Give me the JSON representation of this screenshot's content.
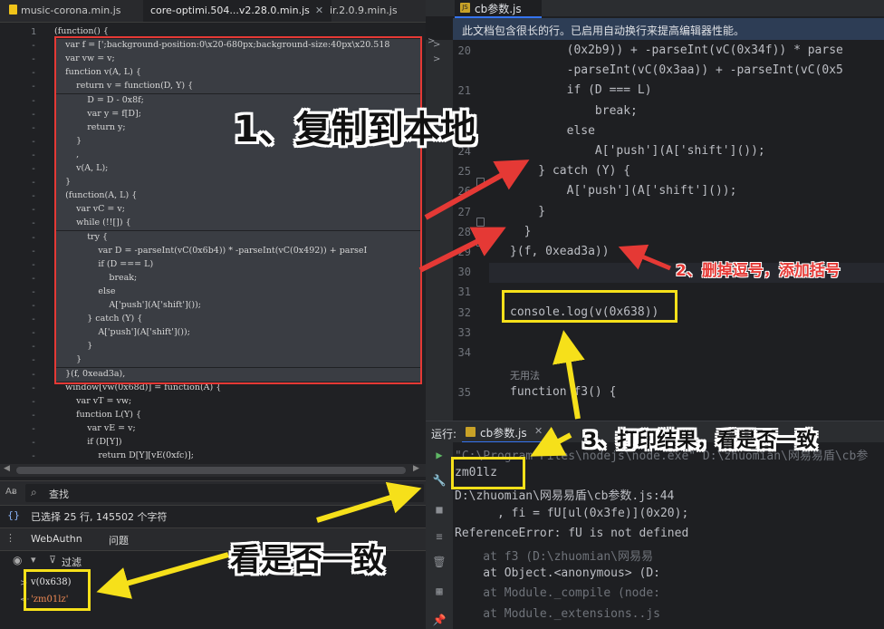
{
  "left_tabs": [
    {
      "label": "music-corona.min.js",
      "active": false
    },
    {
      "label": "core-optimi.504...v2.28.0.min.js",
      "active": true
    },
    {
      "label": "ir.2.0.9.min.js",
      "active": false
    }
  ],
  "left_code": [
    {
      "ln": "1",
      "text": "(function() {"
    },
    {
      "ln": "-",
      "text": "    var f = [';background-position:0\\x20-680px;background-size:40px\\x20.518"
    },
    {
      "ln": "-",
      "text": "    var vw = v;"
    },
    {
      "ln": "-",
      "text": "    function v(A, L) {"
    },
    {
      "ln": "-",
      "text": "        return v = function(D, Y) {"
    },
    {
      "ln": "-",
      "text": "            D = D - 0x8f;"
    },
    {
      "ln": "-",
      "text": "            var y = f[D];"
    },
    {
      "ln": "-",
      "text": "            return y;"
    },
    {
      "ln": "-",
      "text": "        }"
    },
    {
      "ln": "-",
      "text": "        ,"
    },
    {
      "ln": "-",
      "text": "        v(A, L);"
    },
    {
      "ln": "-",
      "text": "    }"
    },
    {
      "ln": "-",
      "text": "    (function(A, L) {"
    },
    {
      "ln": "-",
      "text": "        var vC = v;"
    },
    {
      "ln": "-",
      "text": "        while (!![]) {"
    },
    {
      "ln": "-",
      "text": "            try {"
    },
    {
      "ln": "-",
      "text": "                var D = -parseInt(vC(0x6b4)) * -parseInt(vC(0x492)) + parseI"
    },
    {
      "ln": "-",
      "text": "                if (D === L)"
    },
    {
      "ln": "-",
      "text": "                    break;"
    },
    {
      "ln": "-",
      "text": "                else"
    },
    {
      "ln": "-",
      "text": "                    A['push'](A['shift']());"
    },
    {
      "ln": "-",
      "text": "            } catch (Y) {"
    },
    {
      "ln": "-",
      "text": "                A['push'](A['shift']());"
    },
    {
      "ln": "-",
      "text": "            }"
    },
    {
      "ln": "-",
      "text": "        }"
    },
    {
      "ln": "-",
      "text": "    }(f, 0xead3a),"
    },
    {
      "ln": "-",
      "text": "    window[vw(0x68d)] = function(A) {"
    },
    {
      "ln": "-",
      "text": "        var vT = vw;"
    },
    {
      "ln": "-",
      "text": "        function L(Y) {"
    },
    {
      "ln": "-",
      "text": "            var vE = v;"
    },
    {
      "ln": "-",
      "text": "            if (D[Y])"
    },
    {
      "ln": "-",
      "text": "                return D[Y][vE(0xfc)];"
    }
  ],
  "search": {
    "icon_label": "Aᴃ",
    "placeholder": "查找"
  },
  "status": {
    "text": "已选择 25 行, 145502 个字符"
  },
  "bottom_tabs": {
    "webauthn": "WebAuthn",
    "issues": "问题"
  },
  "filter": {
    "label": "过滤"
  },
  "console_lines": [
    {
      "prefix": ">",
      "text": "v(0x638)"
    },
    {
      "prefix": "<·",
      "text": "'zm01lz'"
    }
  ],
  "right_tab": {
    "label": "cb参数.js"
  },
  "banner": {
    "text": "此文档包含很长的行。已启用自动换行来提高编辑器性能。"
  },
  "right_code": [
    {
      "ln": "20",
      "text": "        (0x2b9)) + -parseInt(vC(0x34f)) * parse"
    },
    {
      "ln": "",
      "text": "        -parseInt(vC(0x3aa)) + -parseInt(vC(0x5"
    },
    {
      "ln": "21",
      "text": "        if (D === L)"
    },
    {
      "ln": "22",
      "text": "            break;"
    },
    {
      "ln": "23",
      "text": "        else"
    },
    {
      "ln": "24",
      "text": "            A['push'](A['shift']());"
    },
    {
      "ln": "25",
      "text": "    } catch (Y) {"
    },
    {
      "ln": "26",
      "text": "        A['push'](A['shift']());"
    },
    {
      "ln": "27",
      "text": "    }"
    },
    {
      "ln": "28",
      "text": "  }"
    },
    {
      "ln": "29",
      "text": "}(f, 0xead3a))"
    },
    {
      "ln": "30",
      "text": ""
    },
    {
      "ln": "31",
      "text": ""
    },
    {
      "ln": "32",
      "text": "console.log(v(0x638))"
    },
    {
      "ln": "33",
      "text": ""
    },
    {
      "ln": "34",
      "text": ""
    },
    {
      "ln": "",
      "text": "无用法"
    },
    {
      "ln": "35",
      "text": "function f3() {"
    }
  ],
  "run": {
    "label": "运行:",
    "config": "cb参数.js"
  },
  "run_output": [
    {
      "text": "\"C:\\Program Files\\nodejs\\node.exe\" D:\\zhuomian\\网易易盾\\cb参",
      "cls": "gray"
    },
    {
      "text": "zm01lz",
      "cls": ""
    },
    {
      "text": "D:\\zhuomian\\网易易盾\\cb参数.js:44",
      "cls": ""
    },
    {
      "text": "      , fi = fU[ul(0x3fe)](0x20);",
      "cls": ""
    },
    {
      "text": "ReferenceError: fU is not defined",
      "cls": ""
    },
    {
      "text": "    at f3 (D:\\zhuomian\\网易易",
      "cls": "gray"
    },
    {
      "text": "    at Object.<anonymous> (D:",
      "cls": ""
    },
    {
      "text": "    at Module._compile (node:",
      "cls": "gray"
    },
    {
      "text": "    at Module._extensions..js",
      "cls": "gray"
    }
  ],
  "annotations": {
    "step1": "1、复制到本地",
    "step2": "2、删掉逗号，添加括号",
    "step3": "3、打印结果，看是否一致",
    "compare": "看是否一致"
  },
  "colors": {
    "red": "#e53935",
    "yellow": "#f6e01a"
  }
}
